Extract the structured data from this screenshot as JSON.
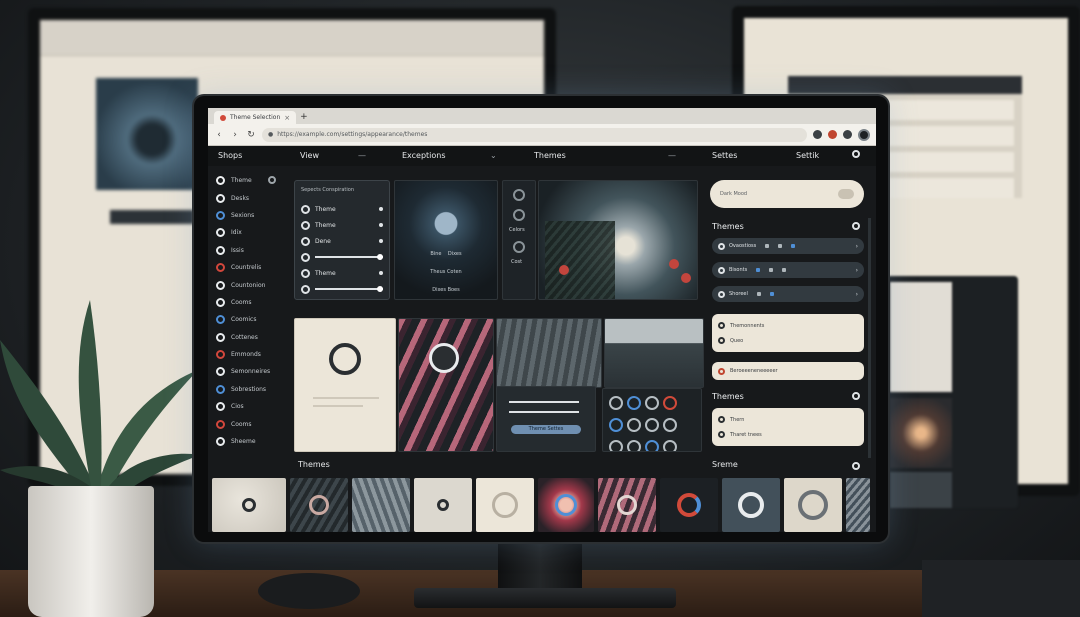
{
  "browser": {
    "tab_title": "Theme Selection",
    "url": "https://example.com/settings/appearance/themes"
  },
  "header": {
    "col1": "Shops",
    "col2": "View",
    "col3": "Exceptions",
    "col4": "Themes",
    "col5": "Settes",
    "col6": "Settik"
  },
  "sidebar": {
    "items": [
      {
        "label": "Theme",
        "icon": "circle-icon"
      },
      {
        "label": "Desks",
        "icon": "circle-icon"
      },
      {
        "label": "Sexions",
        "icon": "circle-icon"
      },
      {
        "label": "Idix",
        "icon": "circle-icon"
      },
      {
        "label": "Issis",
        "icon": "circle-icon"
      },
      {
        "label": "Countrelis",
        "icon": "circle-icon"
      },
      {
        "label": "Countonion",
        "icon": "circle-icon"
      },
      {
        "label": "Cooms",
        "icon": "circle-icon"
      },
      {
        "label": "Coomics",
        "icon": "circle-icon"
      },
      {
        "label": "Cottenes",
        "icon": "circle-icon"
      },
      {
        "label": "Emmonds",
        "icon": "circle-icon"
      },
      {
        "label": "Semonneires",
        "icon": "circle-icon"
      },
      {
        "label": "Sobrestions",
        "icon": "circle-icon"
      },
      {
        "label": "Cios",
        "icon": "circle-icon"
      },
      {
        "label": "Cooms",
        "icon": "circle-icon"
      },
      {
        "label": "Sheeme",
        "icon": "circle-icon"
      }
    ]
  },
  "settings_panel": {
    "header": "Sepects Conspiration",
    "rows": [
      "Theme",
      "Theme",
      "Dene",
      "",
      "Theme",
      ""
    ]
  },
  "moon_card": {
    "labels": [
      "Bine",
      "Dixes"
    ],
    "caption1": "Theus Coten",
    "caption2": "Dixes Boes"
  },
  "ctrl_card": {
    "label1": "Celors",
    "label2": "Cost"
  },
  "right_panel": {
    "search_value": "Dark Mood",
    "heading1": "Themes",
    "pills": [
      {
        "label": "Ovaostioss"
      },
      {
        "label": "Bisonts"
      },
      {
        "label": "Shoreel"
      }
    ],
    "list1": [
      "Themonnents",
      "Queo"
    ],
    "list2": [
      "Beroeeeneneeeeer"
    ],
    "heading2": "Themes",
    "list3": [
      "Thern",
      "Tharet tnees"
    ]
  },
  "sliders_card": {
    "button": "Theme Settes"
  },
  "bottom": {
    "label_left": "Themes",
    "label_right": "Sreme"
  },
  "colors": {
    "accent_red": "#d14a3a",
    "accent_blue": "#4f8fd6",
    "panel": "#24292d",
    "light": "#ece6d9"
  }
}
